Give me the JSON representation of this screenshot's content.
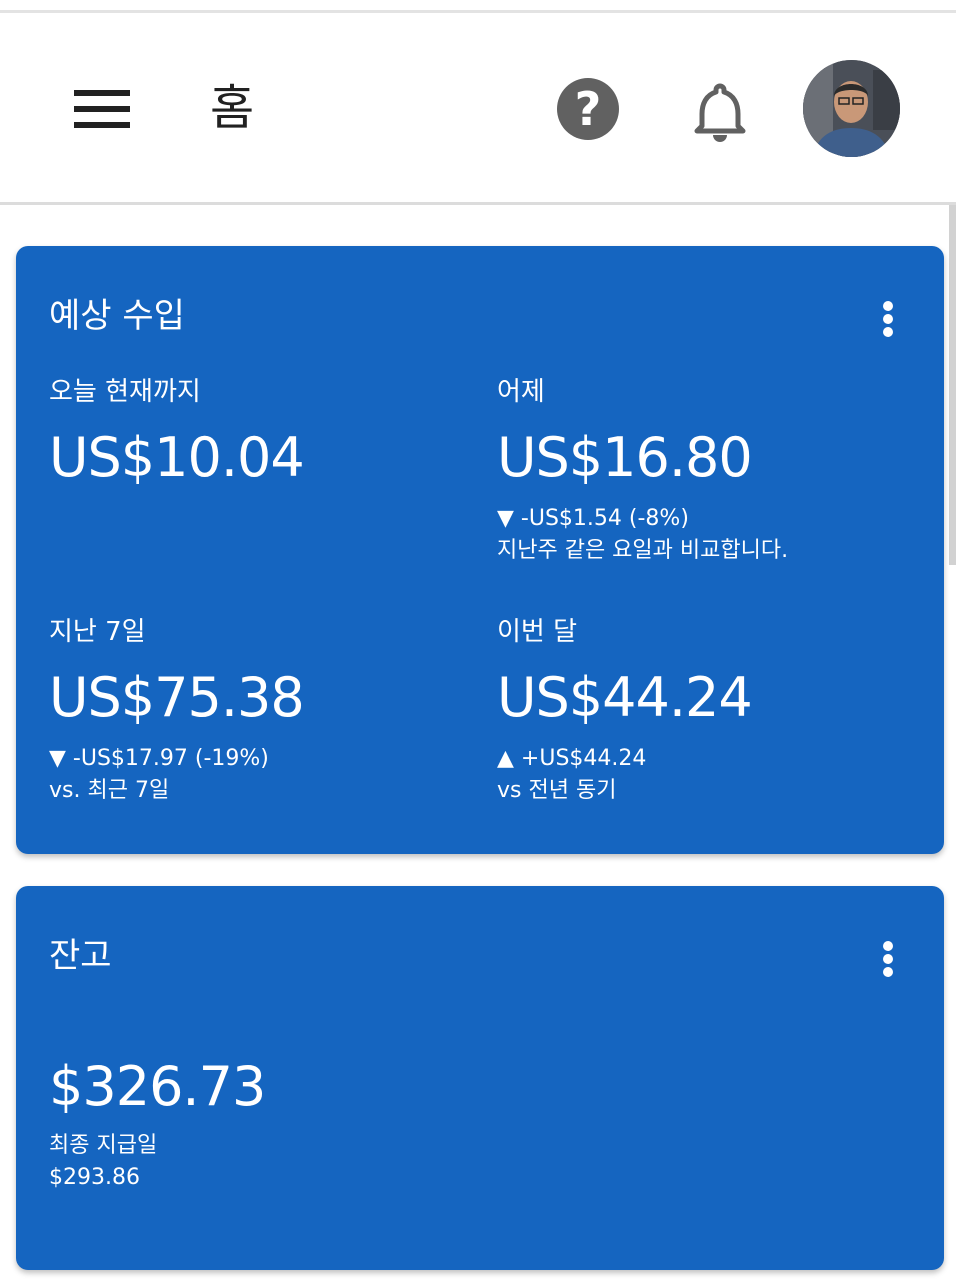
{
  "header": {
    "title": "홈",
    "menu_icon": "menu-icon",
    "help_icon": "help-icon",
    "help_glyph": "?",
    "notification_icon": "bell-icon",
    "avatar": "profile-avatar"
  },
  "estimated_earnings": {
    "title": "예상 수입",
    "today": {
      "label": "오늘 현재까지",
      "value": "US$10.04"
    },
    "yesterday": {
      "label": "어제",
      "value": "US$16.80",
      "change": "▼ -US$1.54 (-8%)",
      "compare": "지난주 같은 요일과 비교합니다."
    },
    "last_7_days": {
      "label": "지난 7일",
      "value": "US$75.38",
      "change": "▼ -US$17.97 (-19%)",
      "compare": "vs. 최근 7일"
    },
    "this_month": {
      "label": "이번 달",
      "value": "US$44.24",
      "change": "▲ +US$44.24",
      "compare": "vs 전년 동기"
    }
  },
  "balance": {
    "title": "잔고",
    "value": "$326.73",
    "last_payment_label": "최종 지급일",
    "last_payment_amount": "$293.86"
  },
  "colors": {
    "card_background": "#1565c0",
    "text_on_card": "#ffffff",
    "icon_gray": "#616161"
  }
}
